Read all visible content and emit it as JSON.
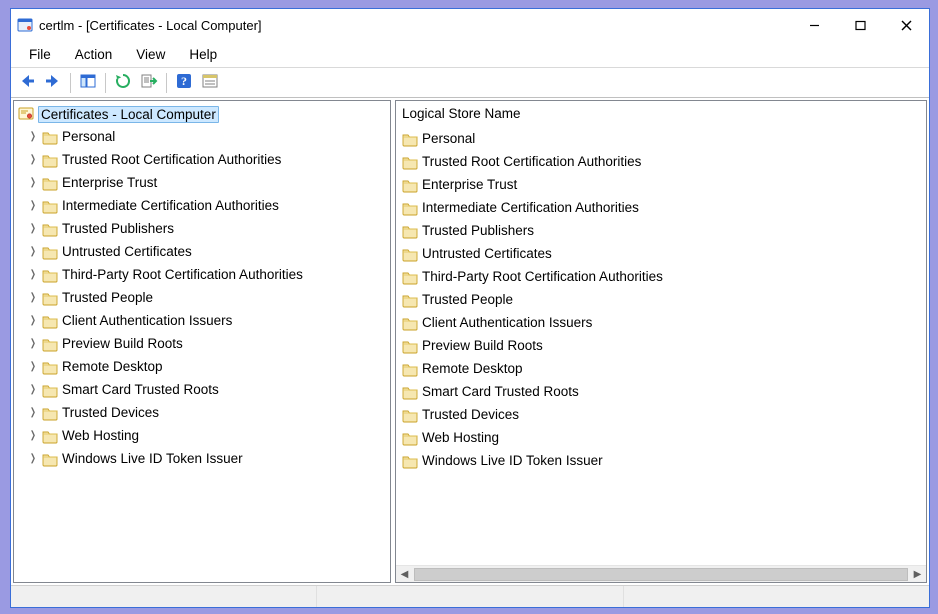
{
  "title": "certlm - [Certificates - Local Computer]",
  "menu": [
    "File",
    "Action",
    "View",
    "Help"
  ],
  "tree": {
    "root_label": "Certificates - Local Computer",
    "children": [
      "Personal",
      "Trusted Root Certification Authorities",
      "Enterprise Trust",
      "Intermediate Certification Authorities",
      "Trusted Publishers",
      "Untrusted Certificates",
      "Third-Party Root Certification Authorities",
      "Trusted People",
      "Client Authentication Issuers",
      "Preview Build Roots",
      "Remote Desktop",
      "Smart Card Trusted Roots",
      "Trusted Devices",
      "Web Hosting",
      "Windows Live ID Token Issuer"
    ]
  },
  "list": {
    "header": "Logical Store Name",
    "items": [
      "Personal",
      "Trusted Root Certification Authorities",
      "Enterprise Trust",
      "Intermediate Certification Authorities",
      "Trusted Publishers",
      "Untrusted Certificates",
      "Third-Party Root Certification Authorities",
      "Trusted People",
      "Client Authentication Issuers",
      "Preview Build Roots",
      "Remote Desktop",
      "Smart Card Trusted Roots",
      "Trusted Devices",
      "Web Hosting",
      "Windows Live ID Token Issuer"
    ]
  }
}
